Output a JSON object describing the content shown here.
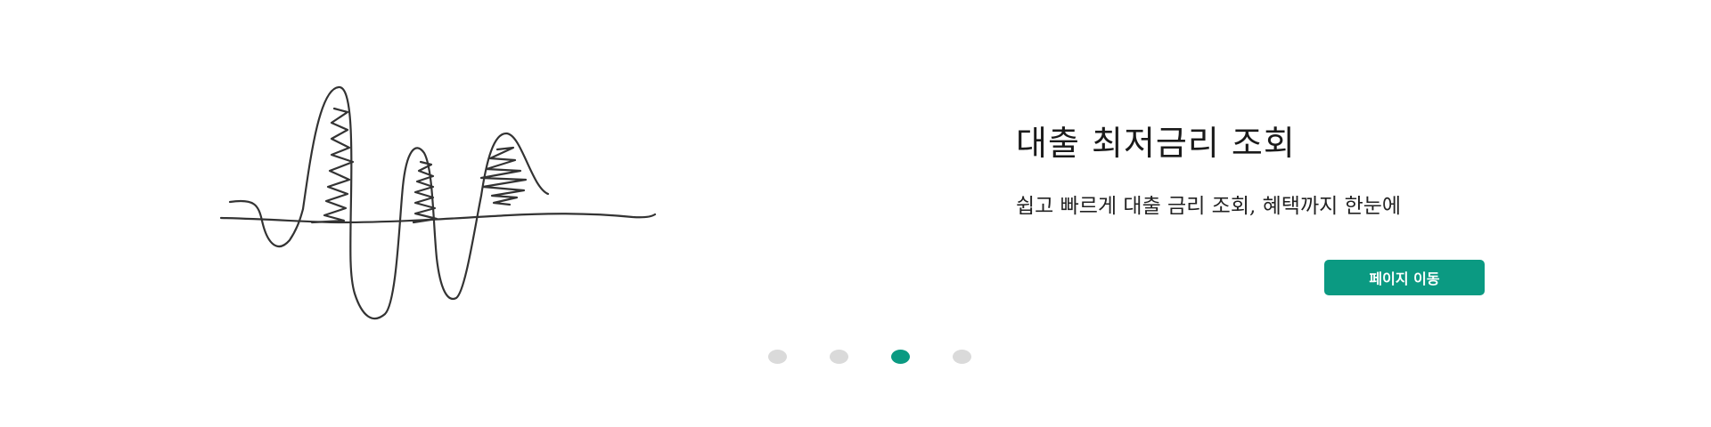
{
  "banner": {
    "title": "대출 최저금리 조회",
    "subtitle": "쉽고 빠르게 대출 금리 조회, 혜택까지 한눈에",
    "cta_label": "페이지 이동",
    "illustration_icon": "squiggle-line-drawing-icon"
  },
  "pager": {
    "total": 4,
    "active_index": 2
  },
  "colors": {
    "accent": "#0b9a82",
    "dot_inactive": "#dadada",
    "line": "#333333",
    "background": "#ffffff"
  }
}
